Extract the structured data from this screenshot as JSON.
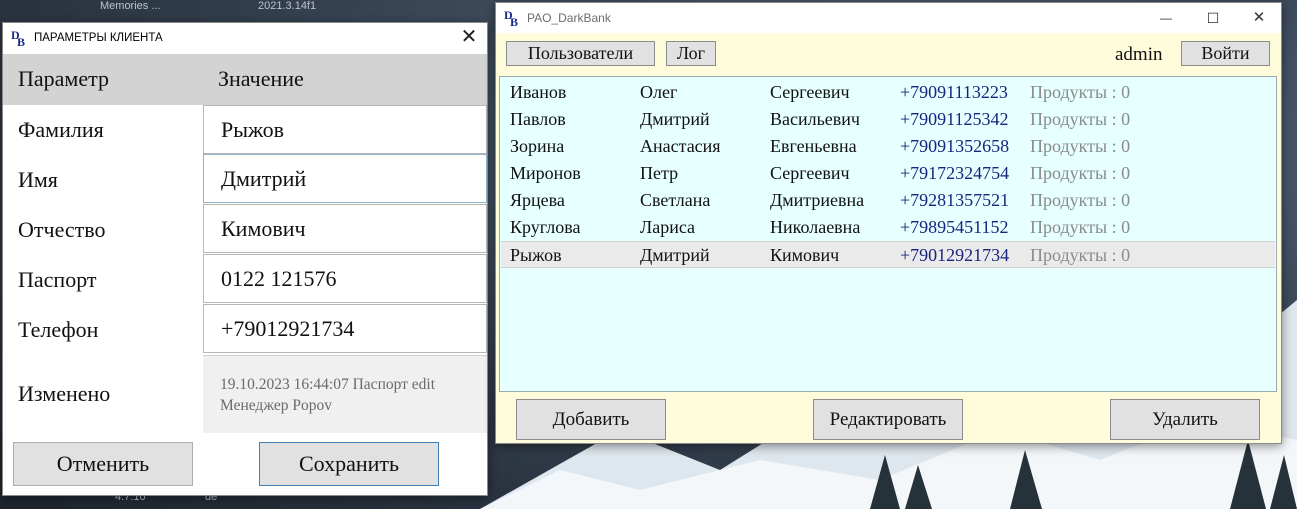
{
  "desktop": {
    "labels": [
      "Memories ...",
      "2021.3.14f1",
      "4.7.10",
      "de"
    ]
  },
  "client_dialog": {
    "title": "ПАРАМЕТРЫ КЛИЕНТА",
    "header_param": "Параметр",
    "header_value": "Значение",
    "fields": {
      "surname_label": "Фамилия",
      "surname_value": "Рыжов",
      "name_label": "Имя",
      "name_value": "Дмитрий",
      "patronymic_label": "Отчество",
      "patronymic_value": "Кимович",
      "passport_label": "Паспорт",
      "passport_value": "0122 121576",
      "phone_label": "Телефон",
      "phone_value": "+79012921734",
      "changed_label": "Изменено",
      "changed_line1": "19.10.2023 16:44:07 Паспорт edit",
      "changed_line2": "Менеджер Popov"
    },
    "cancel_label": "Отменить",
    "save_label": "Сохранить",
    "close_glyph": "✕"
  },
  "bank_window": {
    "title": "PAO_DarkBank",
    "controls": {
      "minimize": "—",
      "maximize": "☐",
      "close": "✕"
    },
    "toolbar": {
      "users_label": "Пользователи",
      "log_label": "Лог"
    },
    "current_user": "admin",
    "login_label": "Войти",
    "clients": [
      {
        "last": "Иванов",
        "first": "Олег",
        "middle": "Сергеевич",
        "phone": "+79091113223",
        "products": "Продукты : 0"
      },
      {
        "last": "Павлов",
        "first": "Дмитрий",
        "middle": "Васильевич",
        "phone": "+79091125342",
        "products": "Продукты : 0"
      },
      {
        "last": "Зорина",
        "first": "Анастасия",
        "middle": "Евгеньевна",
        "phone": "+79091352658",
        "products": "Продукты : 0"
      },
      {
        "last": "Миронов",
        "first": "Петр",
        "middle": "Сергеевич",
        "phone": "+79172324754",
        "products": "Продукты : 0"
      },
      {
        "last": "Ярцева",
        "first": "Светлана",
        "middle": "Дмитриевна",
        "phone": "+79281357521",
        "products": "Продукты : 0"
      },
      {
        "last": "Круглова",
        "first": "Лариса",
        "middle": "Николаевна",
        "phone": "+79895451152",
        "products": "Продукты : 0"
      },
      {
        "last": "Рыжов",
        "first": "Дмитрий",
        "middle": "Кимович",
        "phone": "+79012921734",
        "products": "Продукты : 0"
      }
    ],
    "add_label": "Добавить",
    "edit_label": "Редактировать",
    "delete_label": "Удалить"
  },
  "colors": {
    "list_bg": "#e6ffff",
    "window_bg": "#fffcdc",
    "phone_text": "#1a237e",
    "products_text": "#8b8b8b",
    "selected_row": "#eaeaea"
  }
}
